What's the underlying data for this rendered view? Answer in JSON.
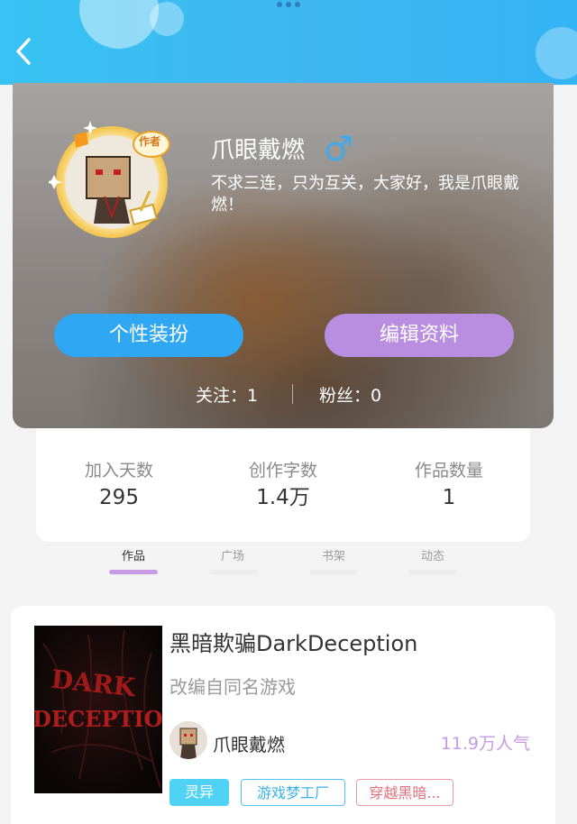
{
  "profile": {
    "username": "爪眼戴燃",
    "gender": "male",
    "bio": "不求三连，只为互关，大家好，我是爪眼戴燃！",
    "badge_text": "作者",
    "buttons": {
      "dress_up": "个性装扮",
      "edit_profile": "编辑资料"
    },
    "follow_text": "关注：1",
    "fans_text": "粉丝：0"
  },
  "stats": [
    {
      "label": "加入天数",
      "value": "295"
    },
    {
      "label": "创作字数",
      "value": "1.4万"
    },
    {
      "label": "作品数量",
      "value": "1"
    }
  ],
  "tabs": [
    {
      "label": "作品",
      "active": true
    },
    {
      "label": "广场",
      "active": false
    },
    {
      "label": "书架",
      "active": false
    },
    {
      "label": "动态",
      "active": false
    }
  ],
  "work": {
    "title": "黑暗欺骗DarkDeception",
    "description": "改编自同名游戏",
    "cover_text_line1": "DARK",
    "cover_text_line2": "DECEPTION",
    "author": "爪眼戴燃",
    "popularity": "11.9万人气",
    "tags": [
      "灵异",
      "游戏梦工厂",
      "穿越黑暗..."
    ]
  },
  "colors": {
    "topbar": "#37c3f3",
    "dress_button": "#2fa7f2",
    "edit_button": "#b98ddf",
    "active_tab": "#c69be4",
    "popularity": "#c49be4"
  },
  "icons": {
    "back": "chevron-left-icon",
    "gender": "male-symbol-icon",
    "more": "more-dots-icon"
  }
}
